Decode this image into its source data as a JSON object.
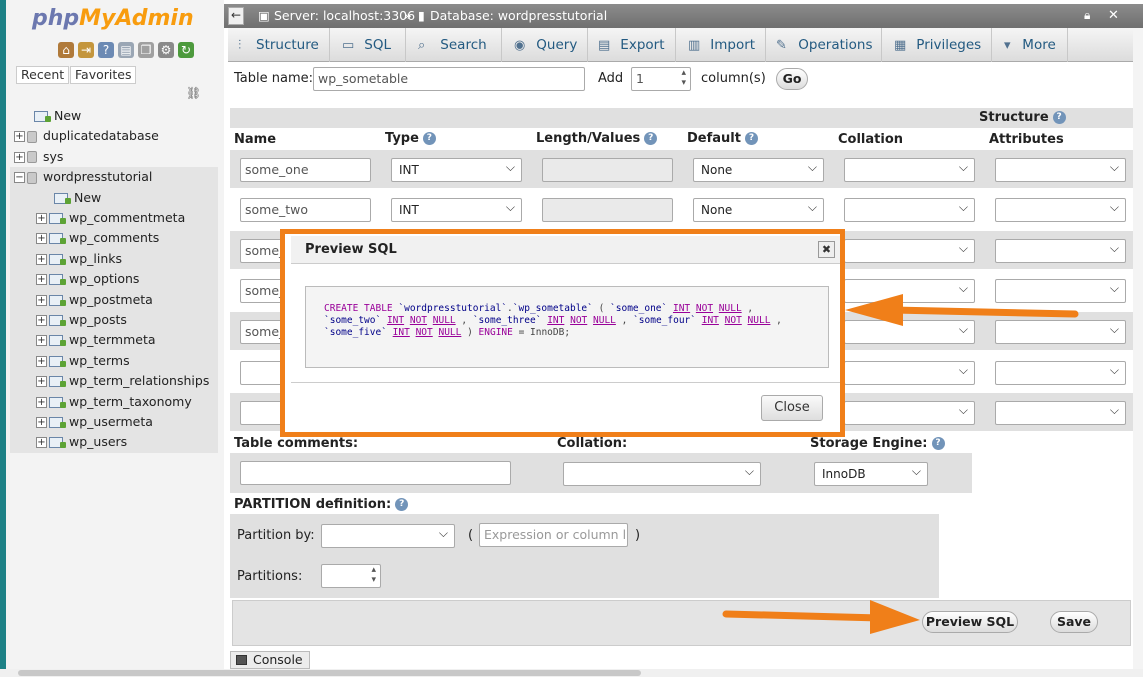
{
  "sidebar": {
    "logo_part1": "php",
    "logo_part2": "MyAdmin",
    "tab_recent": "Recent",
    "tab_favorites": "Favorites",
    "tree": [
      {
        "label": "New",
        "type": "new",
        "level": 0
      },
      {
        "label": "duplicatedatabase",
        "type": "db",
        "level": 0
      },
      {
        "label": "sys",
        "type": "db",
        "level": 0
      },
      {
        "label": "wordpresstutorial",
        "type": "db",
        "level": 0
      },
      {
        "label": "New",
        "type": "new",
        "level": 1
      },
      {
        "label": "wp_commentmeta",
        "type": "table",
        "level": 1
      },
      {
        "label": "wp_comments",
        "type": "table",
        "level": 1
      },
      {
        "label": "wp_links",
        "type": "table",
        "level": 1
      },
      {
        "label": "wp_options",
        "type": "table",
        "level": 1
      },
      {
        "label": "wp_postmeta",
        "type": "table",
        "level": 1
      },
      {
        "label": "wp_posts",
        "type": "table",
        "level": 1
      },
      {
        "label": "wp_termmeta",
        "type": "table",
        "level": 1
      },
      {
        "label": "wp_terms",
        "type": "table",
        "level": 1
      },
      {
        "label": "wp_term_relationships",
        "type": "table",
        "level": 1
      },
      {
        "label": "wp_term_taxonomy",
        "type": "table",
        "level": 1
      },
      {
        "label": "wp_usermeta",
        "type": "table",
        "level": 1
      },
      {
        "label": "wp_users",
        "type": "table",
        "level": 1
      }
    ]
  },
  "breadcrumb": {
    "server": "Server: localhost:3306",
    "sep": "»",
    "database": "Database: wordpresstutorial"
  },
  "menu": {
    "structure": "Structure",
    "sql": "SQL",
    "search": "Search",
    "query": "Query",
    "export": "Export",
    "import": "Import",
    "operations": "Operations",
    "privileges": "Privileges",
    "more": "More"
  },
  "form": {
    "table_name_label": "Table name:",
    "table_name_value": "wp_sometable",
    "add_label": "Add",
    "add_value": "1",
    "columns_label": "column(s)",
    "go_label": "Go",
    "structure_header": "Structure",
    "headers": {
      "name": "Name",
      "type": "Type",
      "length": "Length/Values",
      "default": "Default",
      "collation": "Collation",
      "attributes": "Attributes"
    },
    "rows": [
      {
        "name": "some_one",
        "type": "INT",
        "default": "None"
      },
      {
        "name": "some_two",
        "type": "INT",
        "default": "None"
      },
      {
        "name": "some_",
        "type": "",
        "default": ""
      },
      {
        "name": "some_",
        "type": "",
        "default": ""
      },
      {
        "name": "some_",
        "type": "",
        "default": ""
      },
      {
        "name": "",
        "type": "",
        "default": ""
      },
      {
        "name": "",
        "type": "",
        "default": ""
      }
    ],
    "table_comments_label": "Table comments:",
    "collation_label": "Collation:",
    "storage_engine_label": "Storage Engine:",
    "storage_engine_value": "InnoDB",
    "partition_label": "PARTITION definition:",
    "partition_by_label": "Partition by:",
    "paren_open": "(",
    "paren_close": ")",
    "expression_placeholder": "Expression or column list",
    "partitions_label": "Partitions:",
    "preview_sql_button": "Preview SQL",
    "save_button": "Save"
  },
  "modal": {
    "title": "Preview SQL",
    "close_button": "Close",
    "sql": "CREATE TABLE `wordpresstutorial`.`wp_sometable` ( `some_one` INT NOT NULL , `some_two` INT NOT NULL , `some_three` INT NOT NULL , `some_four` INT NOT NULL , `some_five` INT NOT NULL ) ENGINE = InnoDB;"
  },
  "console_label": "Console",
  "colors": {
    "accent_orange": "#f07f19",
    "link_blue": "#235a81",
    "teal_edge": "#1d8186"
  }
}
